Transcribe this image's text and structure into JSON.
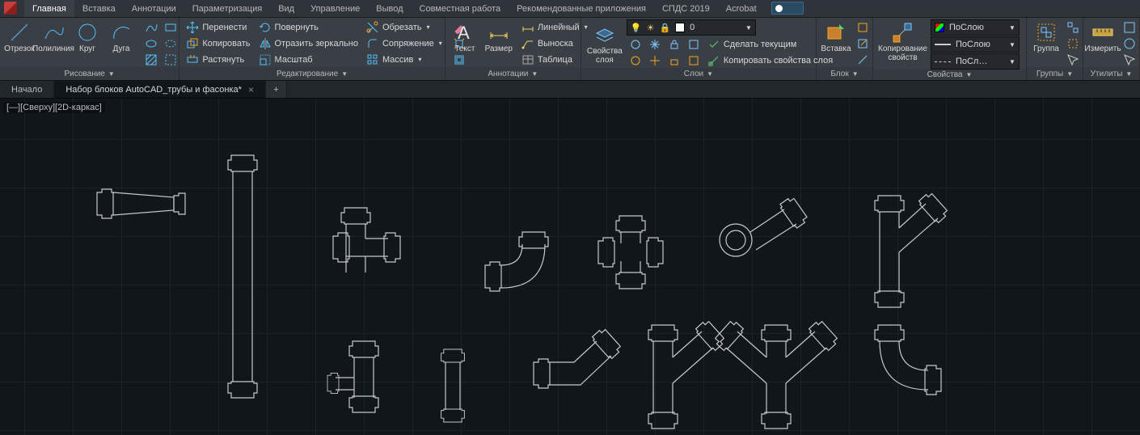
{
  "menu": {
    "tabs": [
      "Главная",
      "Вставка",
      "Аннотации",
      "Параметризация",
      "Вид",
      "Управление",
      "Вывод",
      "Совместная работа",
      "Рекомендованные приложения",
      "СПДС 2019",
      "Acrobat"
    ],
    "active": 0
  },
  "ribbon": {
    "draw": {
      "title": "Рисование",
      "line": "Отрезок",
      "polyline": "Полилиния",
      "circle": "Круг",
      "arc": "Дуга"
    },
    "modify": {
      "title": "Редактирование",
      "move": "Перенести",
      "rotate": "Повернуть",
      "trim": "Обрезать",
      "copy": "Копировать",
      "mirror": "Отразить зеркально",
      "fillet": "Сопряжение",
      "stretch": "Растянуть",
      "scale": "Масштаб",
      "array": "Массив"
    },
    "annot": {
      "title": "Аннотации",
      "text": "Текст",
      "dim": "Размер",
      "linear": "Линейный",
      "leader": "Выноска",
      "table": "Таблица"
    },
    "layers": {
      "title": "Слои",
      "props": "Свойства\nслоя",
      "combo": "0",
      "makecur": "Сделать текущим",
      "copyprops": "Копировать свойства слоя"
    },
    "block": {
      "title": "Блок",
      "insert": "Вставка"
    },
    "props": {
      "title": "Свойства",
      "copy": "Копирование\nсвойств",
      "bylayer": "ПоСлою",
      "linetype": "ПоСлою",
      "lineweight": "ПоСл…"
    },
    "groups": {
      "title": "Группы",
      "btn": "Группа"
    },
    "utils": {
      "title": "Утилиты",
      "measure": "Измерить"
    }
  },
  "filetabs": {
    "start": "Начало",
    "doc": "Набор блоков AutoCAD_трубы и фасонка*"
  },
  "viewport": "[—][Сверху][2D-каркас]"
}
